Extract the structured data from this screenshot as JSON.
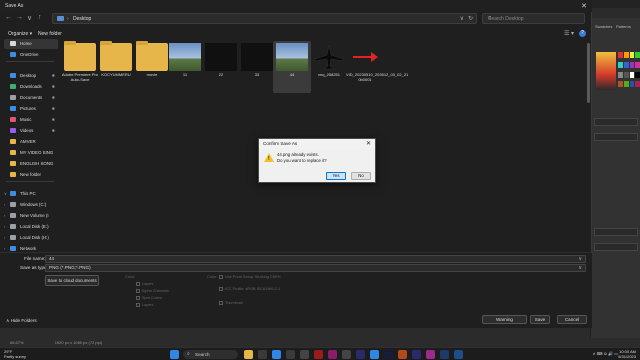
{
  "dialog": {
    "title": "Save As",
    "close_glyph": "✕",
    "nav": {
      "back": "←",
      "forward": "→",
      "up_list": "∨",
      "up": "↑"
    },
    "address": {
      "separator": "›",
      "path": "Desktop",
      "dropdown": "∨",
      "refresh": "↻"
    },
    "search_placeholder": "Search Desktop",
    "commands": {
      "organize": "Organize ▾",
      "new_folder": "New folder",
      "view": "☰ ▾",
      "help": "?"
    }
  },
  "sidebar": {
    "items": [
      {
        "label": "Home",
        "icon": "home-icon",
        "color": "#d9d9d9",
        "active": true
      },
      {
        "label": "OneDrive",
        "icon": "cloud-icon",
        "color": "#3a8ee6"
      },
      {
        "label": "Desktop",
        "icon": "desktop-icon",
        "color": "#3a8ee6",
        "pin": "✱"
      },
      {
        "label": "Downloads",
        "icon": "download-icon",
        "color": "#3ab06a",
        "pin": "✱"
      },
      {
        "label": "Documents",
        "icon": "document-icon",
        "color": "#9aa0a6",
        "pin": "✱"
      },
      {
        "label": "Pictures",
        "icon": "picture-icon",
        "color": "#3a8ee6",
        "pin": "✱"
      },
      {
        "label": "Music",
        "icon": "music-icon",
        "color": "#e0566c",
        "pin": "✱"
      },
      {
        "label": "Videos",
        "icon": "video-icon",
        "color": "#9b5de5",
        "pin": "✱"
      },
      {
        "label": "AMVER",
        "icon": "folder-icon",
        "color": "#e6b64a"
      },
      {
        "label": "MY VIDEO SING",
        "icon": "folder-icon",
        "color": "#e6b64a"
      },
      {
        "label": "ENGLISH SONG",
        "icon": "folder-icon",
        "color": "#e6b64a"
      },
      {
        "label": "New folder",
        "icon": "folder-icon",
        "color": "#e6b64a"
      },
      {
        "label": "This PC",
        "icon": "pc-icon",
        "color": "#3a8ee6",
        "chev": "∨"
      },
      {
        "label": "Windows (C:)",
        "icon": "drive-icon",
        "color": "#9aa0a6",
        "chev": "›"
      },
      {
        "label": "New Volume (I",
        "icon": "drive-icon",
        "color": "#9aa0a6",
        "chev": "›"
      },
      {
        "label": "Local Disk (E:)",
        "icon": "drive-icon",
        "color": "#9aa0a6",
        "chev": "›"
      },
      {
        "label": "Local Disk (H:)",
        "icon": "drive-icon",
        "color": "#9aa0a6",
        "chev": "›"
      },
      {
        "label": "Network",
        "icon": "network-icon",
        "color": "#3a8ee6",
        "chev": "›"
      }
    ]
  },
  "files": [
    {
      "name": "Adobe Premiere Pro Auto-Save",
      "kind": "folder"
    },
    {
      "name": "KOCYUMMERU",
      "kind": "folder"
    },
    {
      "name": "movie",
      "kind": "folder"
    },
    {
      "name": "11",
      "kind": "landscape"
    },
    {
      "name": "22",
      "kind": "dark"
    },
    {
      "name": "33",
      "kind": "dark"
    },
    {
      "name": "44",
      "kind": "landscape",
      "selected": true
    },
    {
      "name": "vnq_258251",
      "kind": "plane"
    },
    {
      "name": "VID_20230510_203512_00_02_21 0b0001",
      "kind": "arrow"
    }
  ],
  "bottom": {
    "file_name_label": "File name:",
    "file_name_value": "44",
    "save_as_type_label": "Save as type:",
    "save_as_type_value": "PNG (*.PNG;*.PNG)",
    "cloud_button": "Save to cloud documents",
    "options_left": [
      "Color:",
      "Layers",
      "Alpha Channels",
      "Spot Colors",
      "Layers"
    ],
    "options_right": [
      "Use Proof Setup: Working CMYK",
      "ICC Profile: sRGB IEC61966-2.1",
      "Thumbnail"
    ],
    "color_label": "Color:",
    "hide_folders": "Hide Folders",
    "warning_button": "Warning",
    "save_button": "Save",
    "cancel_button": "Cancel"
  },
  "confirm": {
    "title": "Confirm Save As",
    "close": "✕",
    "line1": "44.png already exists.",
    "line2": "Do you want to replace it?",
    "yes": "Yes",
    "no": "No",
    "warning_mark": "!"
  },
  "photoshop": {
    "right_tabs": [
      "Swatches",
      "Patterns"
    ],
    "status_left": "66.67%",
    "status_doc": "1920 px x 1080 px (72 ppi)"
  },
  "taskbar": {
    "weather_temp": "29°F",
    "weather_desc": "Partly sunny",
    "search_label": "Search",
    "search_glyph": "⌕",
    "tray": "∧  ⌨  ⊜  🔊  ▭",
    "time": "10:00 AM",
    "date": "5/31/2023"
  },
  "colors": {
    "accent": "#0078d7",
    "folder": "#e6b64a",
    "warning": "#f2c028"
  }
}
